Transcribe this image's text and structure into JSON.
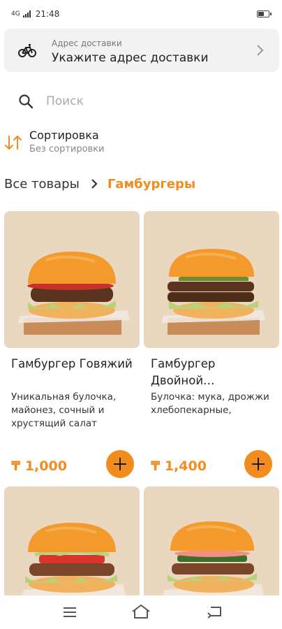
{
  "status_bar": {
    "signal": "4G",
    "time": "21:48"
  },
  "address": {
    "icon": "bicycle-icon",
    "label": "Адрес доставки",
    "value": "Укажите адрес доставки"
  },
  "search": {
    "placeholder": "Поиск",
    "value": ""
  },
  "sort": {
    "title": "Сортировка",
    "value": "Без сортировки"
  },
  "breadcrumb": {
    "root": "Все товары",
    "current": "Гамбургеры"
  },
  "colors": {
    "accent": "#f28c1e",
    "photo_background": "#ead7bf"
  },
  "products": [
    {
      "title": "Гамбургер Говяжий",
      "description": "Уникальная булочка, майонез, сочный и хрустящий салат",
      "price": "₸ 1,000"
    },
    {
      "title": "Гамбургер Двойной…",
      "description": "Булочка: мука, дрожжи хлебопекарные,",
      "price": "₸ 1,400"
    },
    {
      "title": "",
      "description": "",
      "price": ""
    },
    {
      "title": "",
      "description": "",
      "price": ""
    }
  ]
}
